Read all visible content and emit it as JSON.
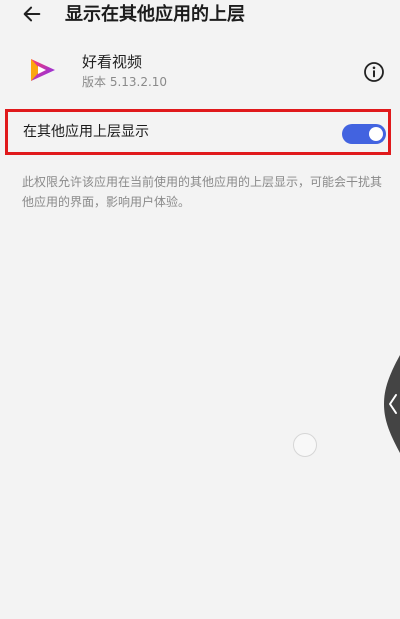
{
  "header": {
    "back_icon": "arrow-left-icon",
    "title": "显示在其他应用的上层"
  },
  "app": {
    "icon": "play-triangle-icon",
    "name": "好看视频",
    "version": "版本 5.13.2.10",
    "info_icon": "info-circle-icon"
  },
  "permission": {
    "label": "在其他应用上层显示",
    "enabled": true,
    "description": "此权限允许该应用在当前使用的其他应用的上层显示，可能会干扰其他应用的界面，影响用户体验。"
  },
  "colors": {
    "background": "#f3f3f3",
    "switch_on": "#4263e0",
    "highlight_border": "#e0191b",
    "app_icon_primary": "#7b2ff7",
    "app_icon_secondary": "#ff3b6b",
    "app_icon_accent": "#ffb300"
  },
  "overlay": {
    "side_handle_icon": "chevron-left-icon",
    "float_button_icon": "floating-circle-icon"
  }
}
